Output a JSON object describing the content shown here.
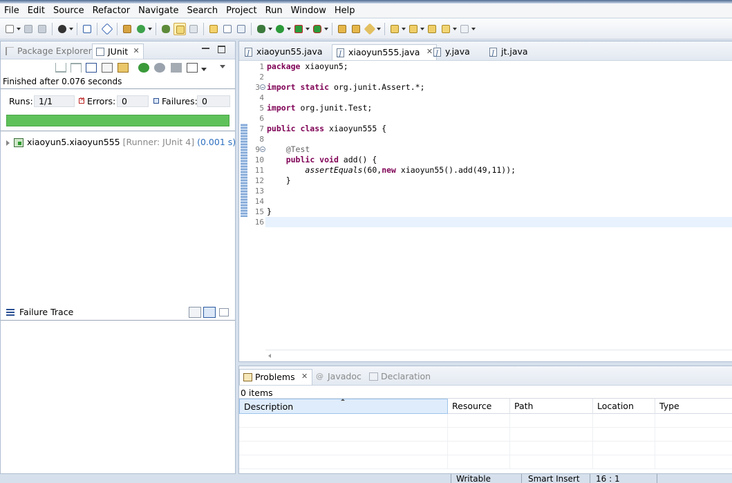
{
  "menu": [
    "File",
    "Edit",
    "Source",
    "Refactor",
    "Navigate",
    "Search",
    "Project",
    "Run",
    "Window",
    "Help"
  ],
  "left_panel": {
    "tabs": [
      {
        "label": "Package Explorer",
        "icon": "package-explorer-icon",
        "active": false
      },
      {
        "label": "JUnit",
        "icon": "junit-icon",
        "active": true
      }
    ],
    "finished_text": "Finished after 0.076 seconds",
    "runs_label": "Runs:",
    "runs_value": "1/1",
    "errors_label": "Errors:",
    "errors_value": "0",
    "failures_label": "Failures:",
    "failures_value": "0",
    "progress": 1.0,
    "progress_color": "#5fc15a",
    "test_item": {
      "name": "xiaoyun5.xiaoyun555",
      "runner": "[Runner: JUnit 4]",
      "time": "(0.001 s)"
    },
    "failure_trace_label": "Failure Trace"
  },
  "editor": {
    "tabs": [
      "xiaoyun55.java",
      "xiaoyun555.java",
      "y.java",
      "jt.java"
    ],
    "active_tab": "xiaoyun555.java",
    "line_numbers": [
      "1",
      "2",
      "3",
      "4",
      "5",
      "6",
      "7",
      "8",
      "9",
      "10",
      "11",
      "12",
      "13",
      "14",
      "15",
      "16"
    ],
    "code": {
      "l1_kw": "package",
      "l1_rest": " xiaoyun5;",
      "l3_kw": "import static",
      "l3_rest": " org.junit.Assert.*;",
      "l5_kw": "import",
      "l5_rest": " org.junit.Test;",
      "l7_kw": "public class",
      "l7_rest": " xiaoyun555 {",
      "l9_ann": "@Test",
      "l10_kw": "public void",
      "l10_rest": " add() {",
      "l11_method": "assertEquals",
      "l11_a": "(60,",
      "l11_kw": "new",
      "l11_b": " xiaoyun55().add(49,11));",
      "l12": "}",
      "l15": "}"
    }
  },
  "problems": {
    "tabs": [
      {
        "label": "Problems",
        "active": true
      },
      {
        "label": "Javadoc",
        "active": false
      },
      {
        "label": "Declaration",
        "active": false
      }
    ],
    "items_count": "0 items",
    "columns": [
      "Description",
      "Resource",
      "Path",
      "Location",
      "Type"
    ]
  },
  "statusbar": {
    "writable": "Writable",
    "insert_mode": "Smart Insert",
    "position": "16 : 1"
  },
  "colors": {
    "keyword": "#7f0055",
    "annotation": "#646464",
    "current_line": "#e8f2fe",
    "time": "#2c6fbf"
  }
}
